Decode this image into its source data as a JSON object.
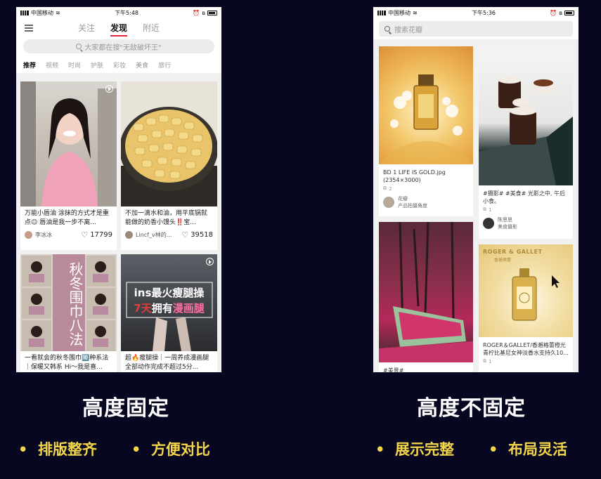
{
  "left_phone": {
    "status": {
      "carrier": "中国移动",
      "time": "下午5:48"
    },
    "tabs": [
      "关注",
      "发现",
      "附近"
    ],
    "active_tab": "发现",
    "search_placeholder": "大家都在搜\"无敌破坏王\"",
    "categories": [
      "推荐",
      "视频",
      "时尚",
      "护肤",
      "彩妆",
      "美食",
      "旅行"
    ],
    "active_category": "推荐",
    "cards": [
      {
        "caption": "万能小唇油 涂抹的方式才是重点😉 唇油是我一步不离...",
        "author": "李冰冰",
        "likes": "17799"
      },
      {
        "caption": "不加一滴水和油，用平底锅就能做的奶香小馒头‼️宝...",
        "author": "Lincf_v林的...",
        "likes": "39518"
      },
      {
        "caption": "一看就会的秋冬围巾🔟种系法｜保暖又韩系 Hi～我是喜...",
        "overlay_text": "秋冬围巾八法"
      },
      {
        "caption": "超🔥瘦腿操｜一周养成漫画腿 全部动作完成不超过5分...",
        "overlay_line1": "ins最火瘦腿操",
        "overlay_line2_a": "7天",
        "overlay_line2_b": "拥有",
        "overlay_line2_c": "漫画腿"
      }
    ]
  },
  "right_phone": {
    "status": {
      "carrier": "中国移动",
      "time": "下午5:36"
    },
    "search_placeholder": "搜索花瓣",
    "cards": [
      {
        "caption": "BD 1 LIFE IS GOLD.jpg (2354×3000)",
        "count": "2",
        "user": "花瓣",
        "board": "产品拍摄角度"
      },
      {
        "caption": "#摄影# #美食# 光影之中, 午后小食。",
        "count": "1",
        "user": "陈思思",
        "board": "美食摄影"
      },
      {
        "caption": "#美景#"
      },
      {
        "brand": "ROGER & GALLET",
        "brand_sub": "香邂格蕾",
        "caption": "ROGER＆GALLET/香邂格蕾橙光青柠比基尼女神淡香水支持久10...",
        "count": "1"
      }
    ]
  },
  "captions": {
    "left_title": "高度固定",
    "left_bullets": [
      "排版整齐",
      "方便对比"
    ],
    "right_title": "高度不固定",
    "right_bullets": [
      "展示完整",
      "布局灵活"
    ]
  },
  "colors": {
    "background": "#070722",
    "bullet": "#f3d64a",
    "accent": "#e2233a"
  }
}
